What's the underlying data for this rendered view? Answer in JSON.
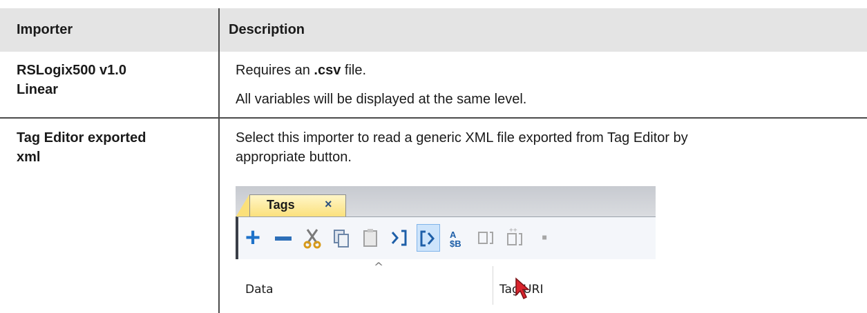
{
  "table": {
    "header": {
      "col1": "Importer",
      "col2": "Description"
    },
    "rows": [
      {
        "importer_line1": "RSLogix500 v1.0",
        "importer_line2": "Linear",
        "desc_prefix": "Requires an ",
        "desc_bold": ".csv",
        "desc_suffix": " file.",
        "desc_para2": "All variables will be displayed at the same level."
      },
      {
        "importer_line1": "Tag Editor exported",
        "importer_line2": "xml",
        "desc_line1": "Select this importer to read a generic XML file exported from Tag Editor by",
        "desc_line2": "appropriate button."
      }
    ]
  },
  "screenshot": {
    "tab_label": "Tags",
    "tab_close": "×",
    "toolbar_icons": [
      "plus-icon",
      "minus-icon",
      "cut-icon",
      "copy-icon",
      "paste-icon",
      "import-icon",
      "export-icon",
      "rename-icon",
      "insert-icon",
      "add-child-icon"
    ],
    "col_data": "Data",
    "col_tag_uri": "Tag URI",
    "sort_glyph": "^"
  },
  "colors": {
    "header_bg": "#e4e4e4",
    "rule": "#4a4a4a",
    "plus_blue": "#1e72c9",
    "minus_blue": "#2d6fb8",
    "cursor_red": "#d9242d"
  }
}
